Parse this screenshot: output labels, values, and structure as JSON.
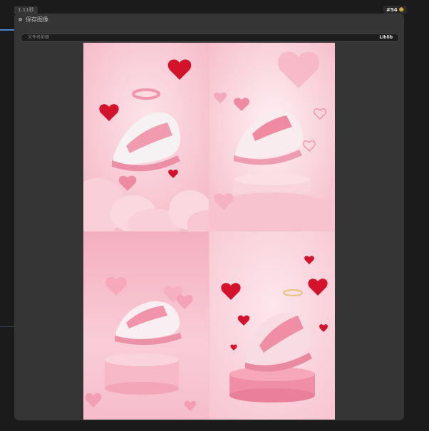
{
  "top_badge": {
    "timing": "1.11秒"
  },
  "node": {
    "id_label": "#54",
    "id_mark": "☻",
    "title": "保存图像",
    "filename_prefix": {
      "label": "文件名前缀",
      "value": "Liblib"
    }
  },
  "images": [
    {
      "name": "pink-sneaker-hearts-clouds"
    },
    {
      "name": "pink-sneaker-podium-hearts"
    },
    {
      "name": "pink-sneaker-cylinder-stage"
    },
    {
      "name": "pink-sneaker-halo-red-hearts"
    }
  ],
  "colors": {
    "canvas_bg": "#1b1b1b",
    "node_bg": "#353535",
    "wire": "#4a86c6",
    "pink_light": "#f9d3dc",
    "pink_mid": "#f2a9bb",
    "heart_red": "#d4122b"
  }
}
